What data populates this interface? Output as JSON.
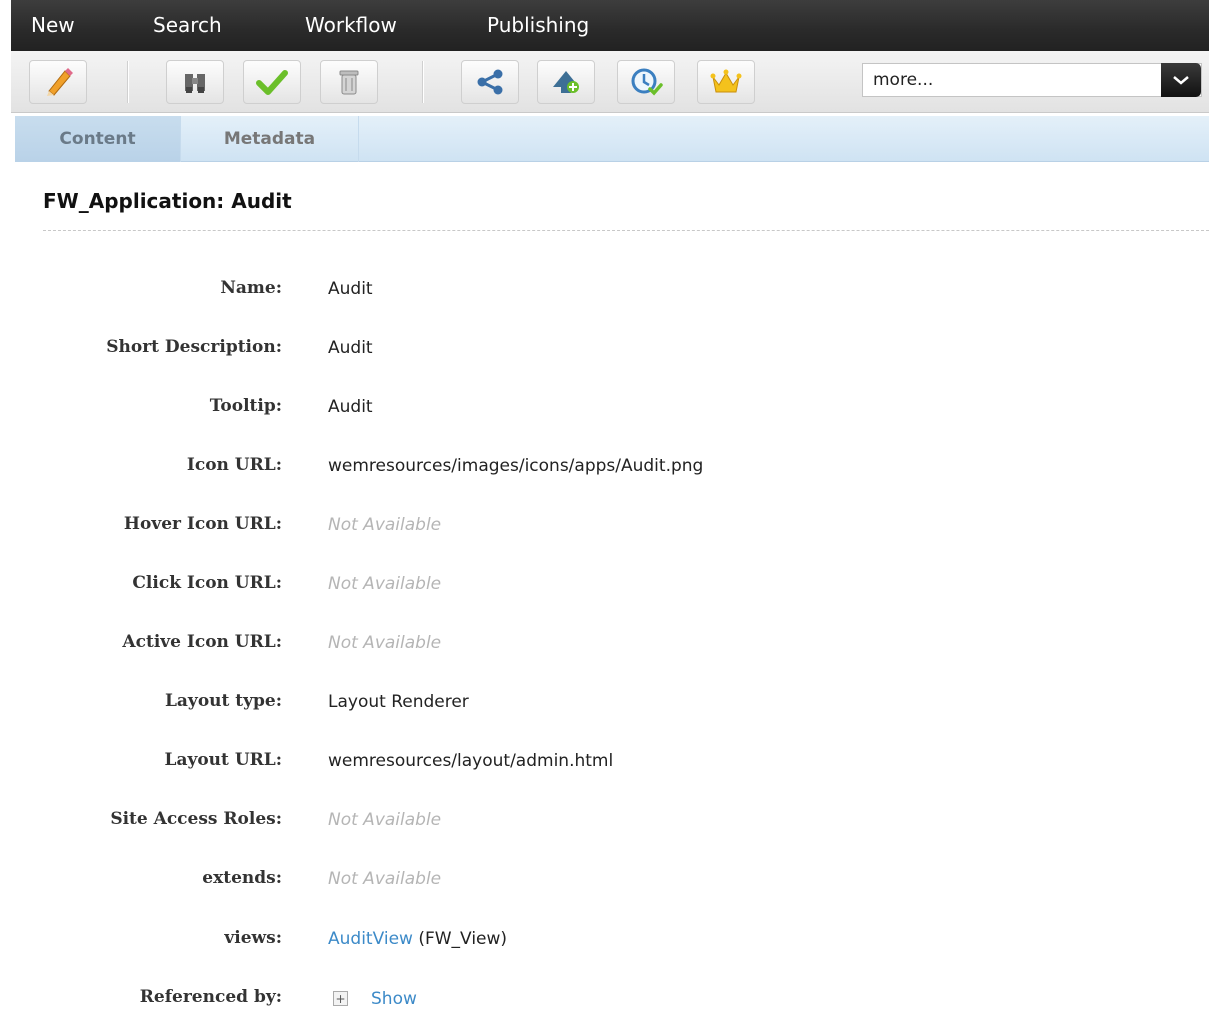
{
  "menu": {
    "new": "New",
    "search": "Search",
    "workflow": "Workflow",
    "publishing": "Publishing"
  },
  "toolbar": {
    "buttons": [
      {
        "name": "edit",
        "icon": "pencil-icon"
      },
      {
        "name": "inspect",
        "icon": "binoculars-icon"
      },
      {
        "name": "approve",
        "icon": "checkmark-icon"
      },
      {
        "name": "delete",
        "icon": "trash-icon"
      },
      {
        "name": "share",
        "icon": "share-icon"
      },
      {
        "name": "add-to-workflow",
        "icon": "bird-add-icon"
      },
      {
        "name": "schedule",
        "icon": "clock-icon"
      },
      {
        "name": "promote",
        "icon": "crown-icon"
      }
    ],
    "more_label": "more..."
  },
  "tabs": {
    "content": "Content",
    "metadata": "Metadata",
    "active": "Content"
  },
  "page": {
    "title": "FW_Application: Audit"
  },
  "fields": {
    "name": {
      "label": "Name:",
      "value": "Audit"
    },
    "short_description": {
      "label": "Short Description:",
      "value": "Audit"
    },
    "tooltip": {
      "label": "Tooltip:",
      "value": "Audit"
    },
    "icon_url": {
      "label": "Icon URL:",
      "value": "wemresources/images/icons/apps/Audit.png"
    },
    "hover_icon_url": {
      "label": "Hover Icon URL:",
      "value": "Not Available"
    },
    "click_icon_url": {
      "label": "Click Icon URL:",
      "value": "Not Available"
    },
    "active_icon_url": {
      "label": "Active Icon URL:",
      "value": "Not Available"
    },
    "layout_type": {
      "label": "Layout type:",
      "value": "Layout Renderer"
    },
    "layout_url": {
      "label": "Layout URL:",
      "value": "wemresources/layout/admin.html"
    },
    "site_access_roles": {
      "label": "Site Access Roles:",
      "value": "Not Available"
    },
    "extends": {
      "label": "extends:",
      "value": "Not Available"
    },
    "views": {
      "label": "views:",
      "link": "AuditView",
      "suffix": " (FW_View)"
    },
    "referenced_by": {
      "label": "Referenced by:",
      "expand": "+",
      "link": "Show"
    }
  },
  "colors": {
    "menubar": "#2a2a2a",
    "tab_bar": "#cfe3f3",
    "link": "#3c8ac8",
    "not_available": "#b5b5b5"
  }
}
